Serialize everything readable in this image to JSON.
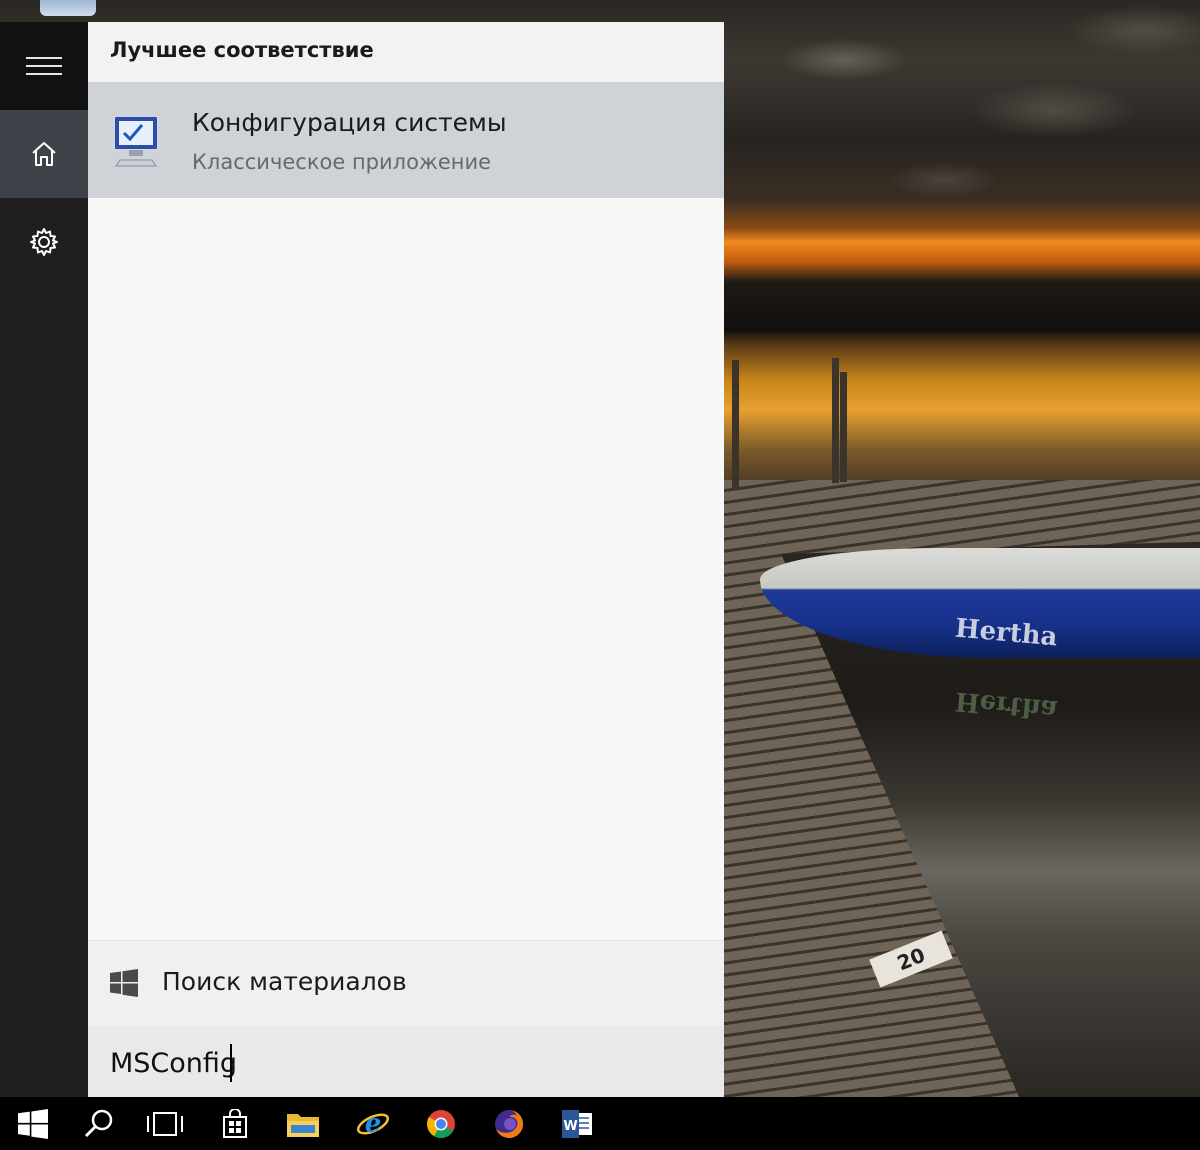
{
  "search_panel": {
    "section_header": "Лучшее соответствие",
    "best_match": {
      "title": "Конфигурация системы",
      "subtitle": "Классическое приложение",
      "icon": "system-configuration-icon"
    },
    "web_search_label": "Поиск материалов",
    "query": "MSConfig"
  },
  "rail": {
    "items": [
      {
        "name": "menu",
        "icon": "hamburger-menu-icon"
      },
      {
        "name": "home",
        "icon": "home-icon"
      },
      {
        "name": "settings",
        "icon": "gear-icon"
      }
    ]
  },
  "taskbar": {
    "items": [
      {
        "name": "start",
        "icon": "windows-logo-icon"
      },
      {
        "name": "search",
        "icon": "search-icon"
      },
      {
        "name": "task-view",
        "icon": "task-view-icon"
      },
      {
        "name": "store",
        "icon": "store-icon"
      },
      {
        "name": "file-explorer",
        "icon": "folder-icon"
      },
      {
        "name": "internet-explorer",
        "icon": "internet-explorer-icon"
      },
      {
        "name": "chrome",
        "icon": "chrome-icon"
      },
      {
        "name": "firefox",
        "icon": "firefox-icon"
      },
      {
        "name": "word",
        "icon": "word-icon"
      }
    ]
  },
  "wallpaper": {
    "boat_name": "Hertha",
    "pier_plate": "20"
  },
  "colors": {
    "rail_bg": "#1f1f1f",
    "rail_selected": "#3d4348",
    "panel_bg": "#f2f2f2",
    "best_match_bg": "#cfd2d6",
    "taskbar_bg": "#000000"
  }
}
